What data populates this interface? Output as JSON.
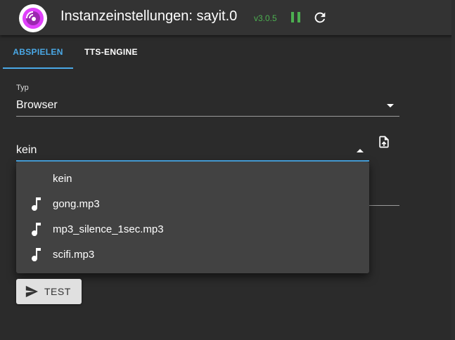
{
  "header": {
    "title": "Instanzeinstellungen: sayit.0",
    "version": "v3.0.5"
  },
  "tabs": [
    {
      "label": "ABSPIELEN",
      "active": true
    },
    {
      "label": "TTS-ENGINE",
      "active": false
    }
  ],
  "form": {
    "type_label": "Typ",
    "type_value": "Browser",
    "sound_value": "kein"
  },
  "dropdown": {
    "items": [
      {
        "label": "kein",
        "icon": ""
      },
      {
        "label": "gong.mp3",
        "icon": "music-note-icon"
      },
      {
        "label": "mp3_silence_1sec.mp3",
        "icon": "music-note-icon"
      },
      {
        "label": "scifi.mp3",
        "icon": "music-note-icon"
      }
    ]
  },
  "actions": {
    "test_label": "TEST"
  },
  "colors": {
    "accent": "#4aa8e6",
    "status_green": "#4caf50",
    "background": "#2b2b2b",
    "header": "#333333",
    "menu": "#424242"
  }
}
